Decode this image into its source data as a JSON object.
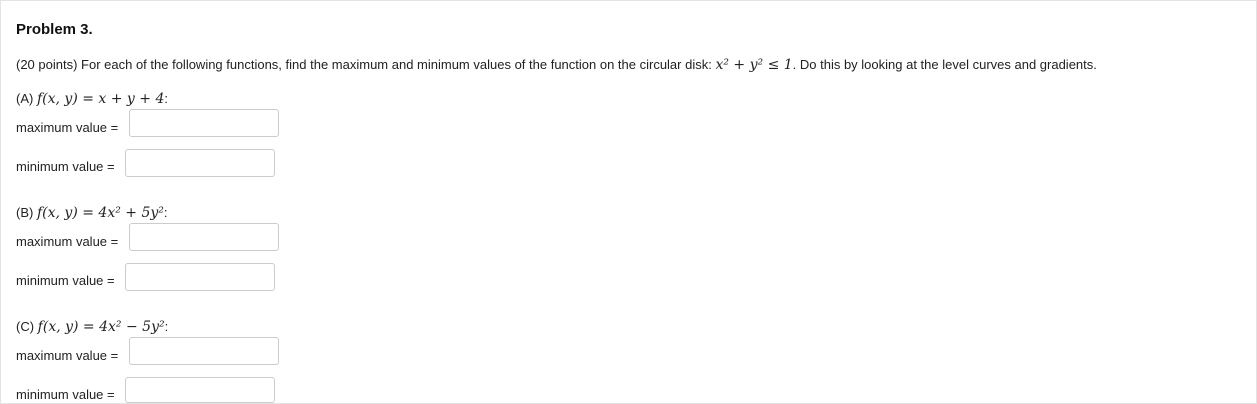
{
  "problem": {
    "title": "Problem 3.",
    "intro_prefix": "(20 points) For each of the following functions, find the maximum and minimum values of the function on the circular disk: ",
    "disk_math": "x² + y² ≤ 1",
    "intro_suffix": ". Do this by looking at the level curves and gradients."
  },
  "parts": [
    {
      "label": "(A)",
      "function": "f(x, y) = x + y + 4",
      "max_label": "maximum value =",
      "max_value": "",
      "min_label": "minimum value =",
      "min_value": ""
    },
    {
      "label": "(B)",
      "function": "f(x, y) = 4x² + 5y²",
      "max_label": "maximum value =",
      "max_value": "",
      "min_label": "minimum value =",
      "min_value": ""
    },
    {
      "label": "(C)",
      "function": "f(x, y) = 4x² − 5y²",
      "max_label": "maximum value =",
      "max_value": "",
      "min_label": "minimum value =",
      "min_value": ""
    }
  ]
}
